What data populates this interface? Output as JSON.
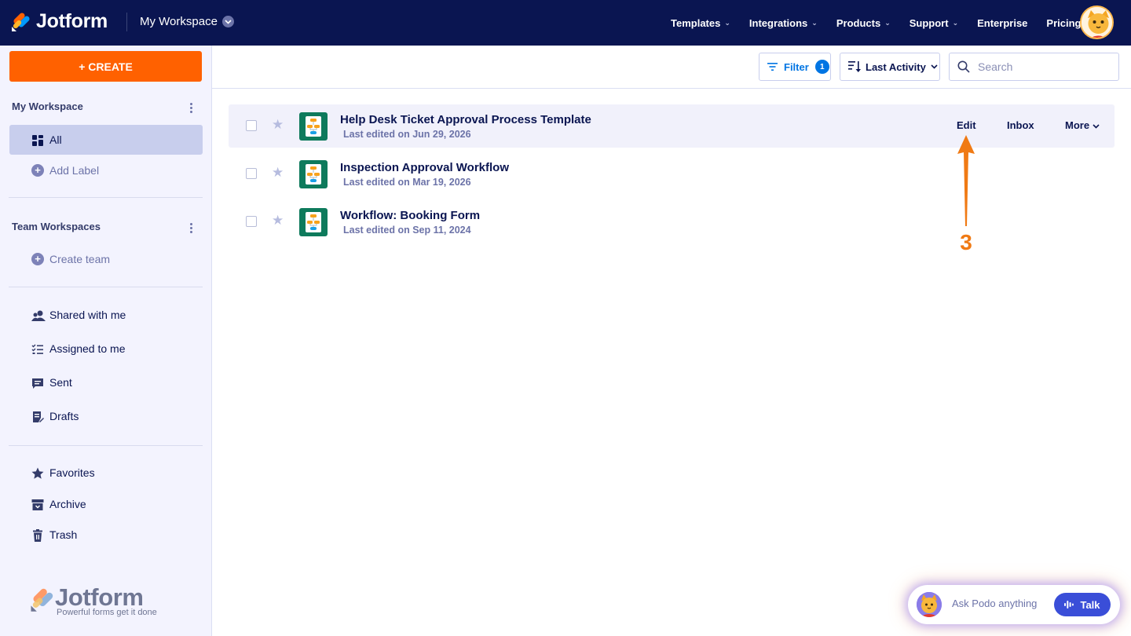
{
  "brand": {
    "name": "Jotform",
    "tagline": "Powerful forms get it done"
  },
  "topnav": {
    "workspace": "My Workspace",
    "links": [
      {
        "label": "Templates",
        "dropdown": true
      },
      {
        "label": "Integrations",
        "dropdown": true
      },
      {
        "label": "Products",
        "dropdown": true
      },
      {
        "label": "Support",
        "dropdown": true
      },
      {
        "label": "Enterprise",
        "dropdown": false
      },
      {
        "label": "Pricing",
        "dropdown": false
      }
    ]
  },
  "sidebar": {
    "create_label": "+ CREATE",
    "my_workspace_heading": "My Workspace",
    "all_label": "All",
    "add_label": "Add Label",
    "team_heading": "Team Workspaces",
    "create_team": "Create team",
    "shared": "Shared with me",
    "assigned": "Assigned to me",
    "sent": "Sent",
    "drafts": "Drafts",
    "favorites": "Favorites",
    "archive": "Archive",
    "trash": "Trash"
  },
  "toolbar": {
    "filter_label": "Filter",
    "filter_count": "1",
    "sort_label": "Last Activity",
    "search_placeholder": "Search"
  },
  "forms": [
    {
      "title": "Help Desk Ticket Approval Process Template",
      "subtitle": "Last edited on Jun 29, 2026"
    },
    {
      "title": "Inspection Approval Workflow",
      "subtitle": "Last edited on Mar 19, 2026"
    },
    {
      "title": "Workflow: Booking Form",
      "subtitle": "Last edited on Sep 11, 2024"
    }
  ],
  "row_actions": {
    "edit": "Edit",
    "inbox": "Inbox",
    "more": "More"
  },
  "annotation": {
    "step": "3",
    "color": "#f07a14"
  },
  "podo": {
    "prompt": "Ask Podo anything",
    "talk": "Talk"
  },
  "colors": {
    "navy": "#0a1551",
    "orange": "#ff6100",
    "blue": "#0075e3",
    "form_icon": "#0e7a5c"
  }
}
